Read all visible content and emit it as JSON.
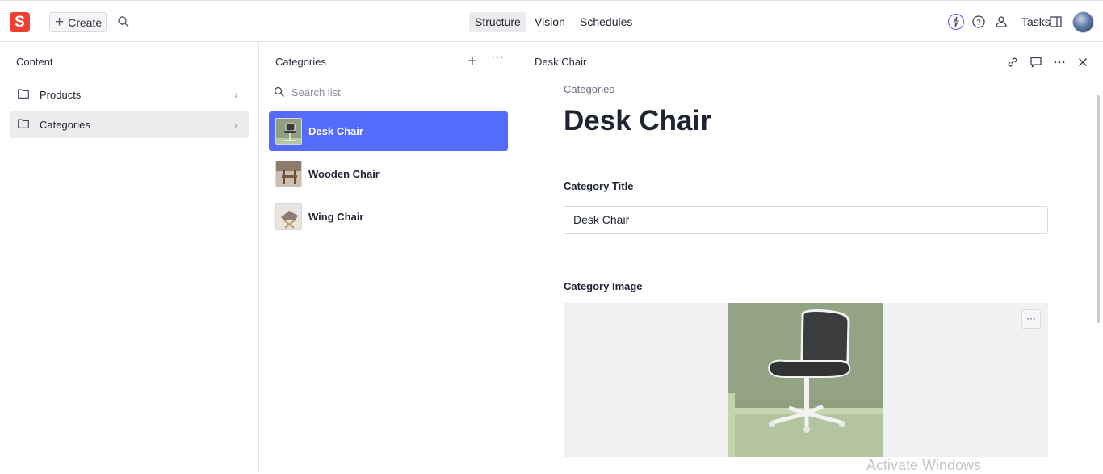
{
  "topbar": {
    "logo_letter": "S",
    "create_label": "Create",
    "nav": [
      {
        "label": "Structure",
        "active": true
      },
      {
        "label": "Vision",
        "active": false
      },
      {
        "label": "Schedules",
        "active": false
      }
    ],
    "tasks_label": "Tasks",
    "icons": [
      "lightning-icon",
      "help-icon",
      "users-icon",
      "panel-icon"
    ],
    "accent_color": "#f03e2f"
  },
  "content_pane": {
    "title": "Content",
    "items": [
      {
        "label": "Products",
        "selected": false
      },
      {
        "label": "Categories",
        "selected": true
      }
    ]
  },
  "categories_pane": {
    "title": "Categories",
    "search_placeholder": "Search list",
    "items": [
      {
        "label": "Desk Chair",
        "selected": true
      },
      {
        "label": "Wooden Chair",
        "selected": false
      },
      {
        "label": "Wing Chair",
        "selected": false
      }
    ],
    "selected_color": "#556bfc"
  },
  "document_pane": {
    "header_title": "Desk Chair",
    "breadcrumb": "Categories",
    "title": "Desk Chair",
    "fields": {
      "title_label": "Category Title",
      "title_value": "Desk Chair",
      "image_label": "Category Image"
    }
  },
  "watermark": "Activate Windows"
}
